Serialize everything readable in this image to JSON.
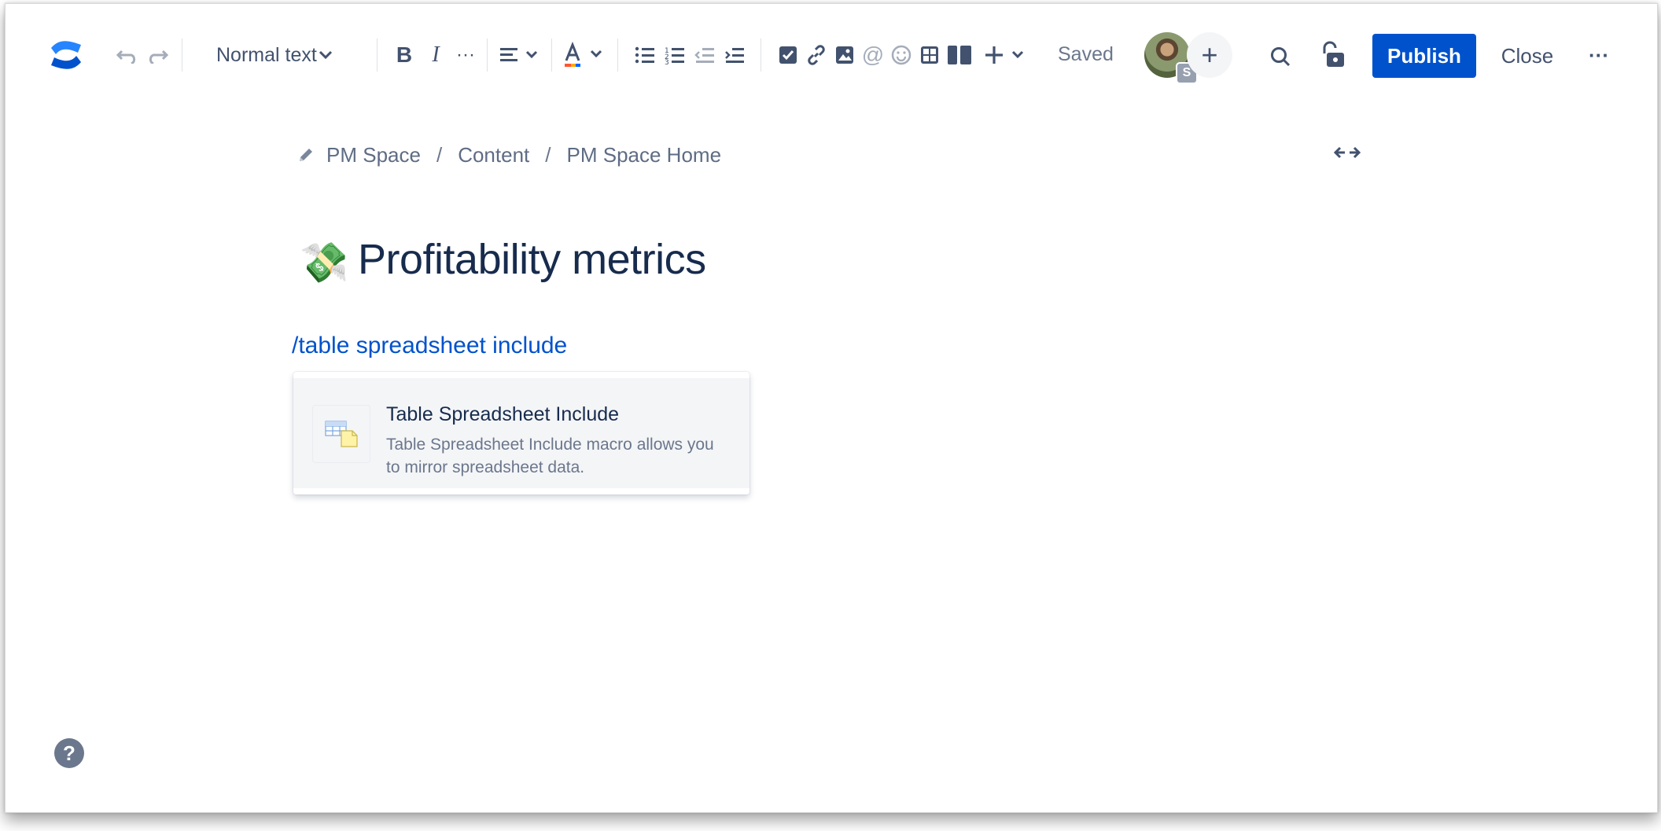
{
  "toolbar": {
    "logo_icon": "confluence-logo-icon",
    "text_style": "Normal text",
    "saved_status": "Saved",
    "collaborator_badge": "S",
    "publish_label": "Publish",
    "close_label": "Close",
    "accent_color": "#0052cc"
  },
  "breadcrumb": {
    "items": [
      "PM Space",
      "Content",
      "PM Space Home"
    ],
    "separator": "/"
  },
  "page": {
    "emoji": "💸",
    "title": "Profitability metrics",
    "slash_command": "/table spreadsheet include"
  },
  "popup": {
    "item_title": "Table Spreadsheet Include",
    "item_description": "Table Spreadsheet Include macro allows you to mirror spreadsheet data."
  },
  "help": {
    "label": "?"
  }
}
